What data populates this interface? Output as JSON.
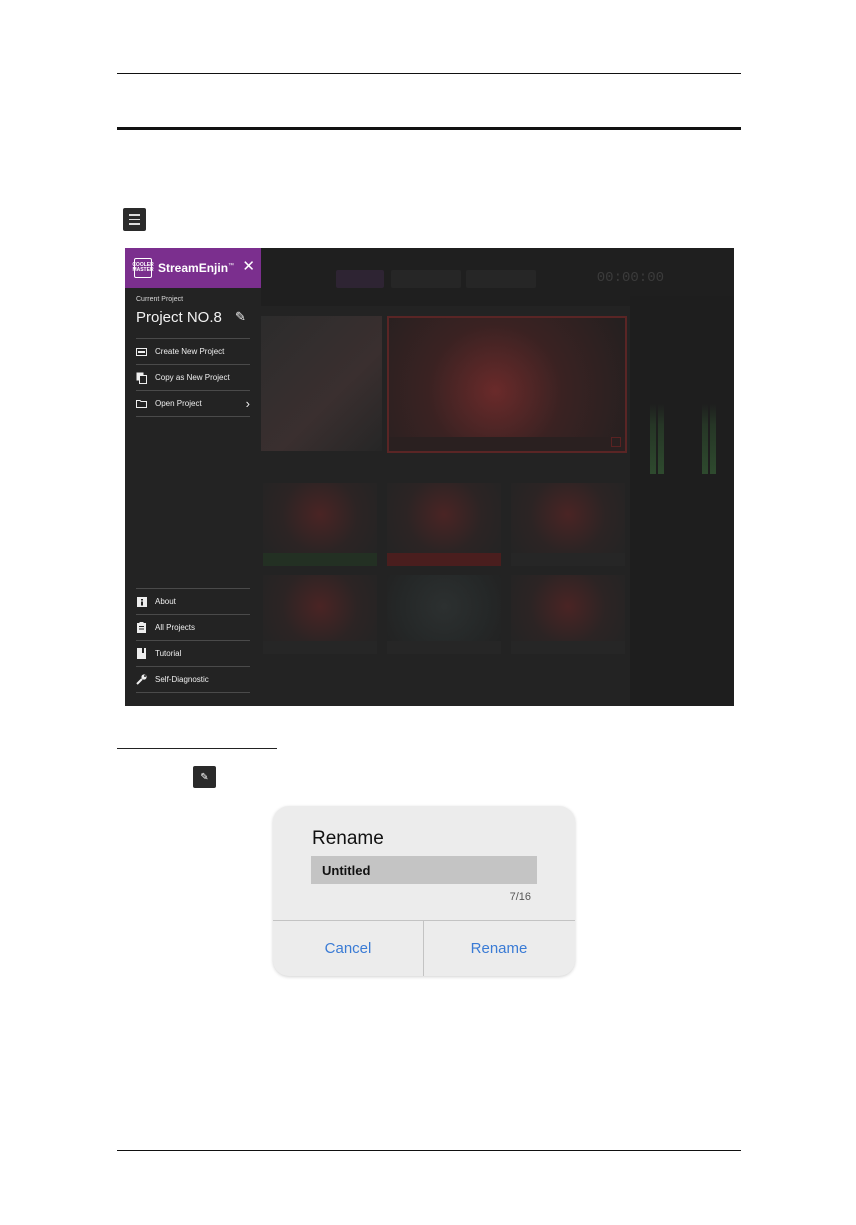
{
  "document": {
    "menu_icon": "hamburger-menu-icon",
    "pencil_icon": "pencil-icon"
  },
  "app": {
    "brand": "StreamEnjin",
    "trademark": "™",
    "logo_text": "COOLER MASTER",
    "current_project_label": "Current Project",
    "current_project_name": "Project NO.8",
    "accent_color": "#7b2f8e",
    "menu_items": [
      {
        "label": "Create New Project",
        "icon": "new-project-icon"
      },
      {
        "label": "Copy as New Project",
        "icon": "copy-icon"
      },
      {
        "label": "Open Project",
        "icon": "folder-icon"
      }
    ],
    "bottom_items": [
      {
        "label": "About",
        "icon": "info-icon"
      },
      {
        "label": "All Projects",
        "icon": "clipboard-icon"
      },
      {
        "label": "Tutorial",
        "icon": "book-icon"
      },
      {
        "label": "Self-Diagnostic",
        "icon": "wrench-icon"
      }
    ],
    "timer": "00:00:00"
  },
  "dialog": {
    "title": "Rename",
    "input_value": "Untitled",
    "char_count": "7/16",
    "cancel_label": "Cancel",
    "confirm_label": "Rename",
    "button_color": "#3a7bd5"
  }
}
